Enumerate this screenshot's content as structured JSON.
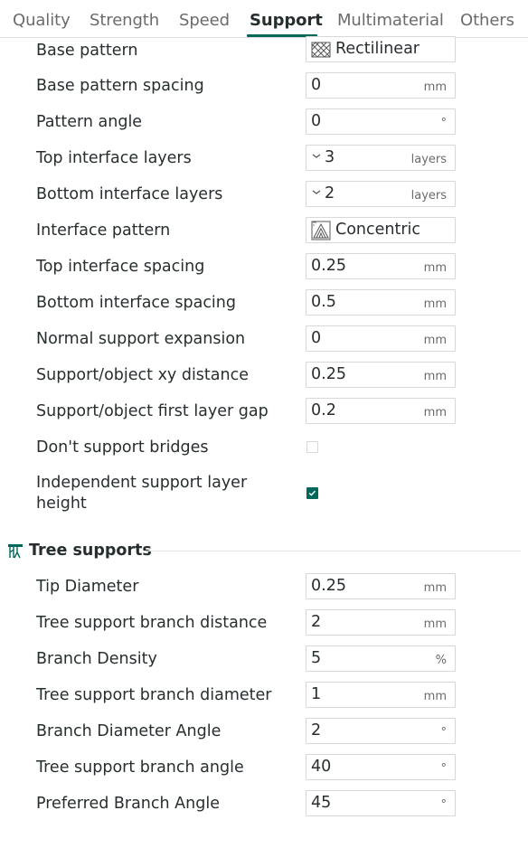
{
  "tabs": [
    {
      "label": "Quality"
    },
    {
      "label": "Strength"
    },
    {
      "label": "Speed"
    },
    {
      "label": "Support"
    },
    {
      "label": "Multimaterial"
    },
    {
      "label": "Others"
    }
  ],
  "active_tab": "Support",
  "accent_color": "#00675b",
  "settings": [
    {
      "label": "Base pattern",
      "value": "Rectilinear",
      "icon": "rectilinear-pattern-icon"
    },
    {
      "label": "Base pattern spacing",
      "value": "0",
      "unit": "mm"
    },
    {
      "label": "Pattern angle",
      "value": "0",
      "unit": "°"
    },
    {
      "label": "Top interface layers",
      "value": "3",
      "unit": "layers"
    },
    {
      "label": "Bottom interface layers",
      "value": "2",
      "unit": "layers"
    },
    {
      "label": "Interface pattern",
      "value": "Concentric",
      "icon": "concentric-pattern-icon"
    },
    {
      "label": "Top interface spacing",
      "value": "0.25",
      "unit": "mm"
    },
    {
      "label": "Bottom interface spacing",
      "value": "0.5",
      "unit": "mm"
    },
    {
      "label": "Normal support expansion",
      "value": "0",
      "unit": "mm"
    },
    {
      "label": "Support/object xy distance",
      "value": "0.25",
      "unit": "mm"
    },
    {
      "label": "Support/object first layer gap",
      "value": "0.2",
      "unit": "mm"
    },
    {
      "label": "Don't support bridges",
      "checked": false
    },
    {
      "label": "Independent support layer height",
      "checked": true
    }
  ],
  "tree_section": {
    "title": "Tree supports",
    "icon": "tree-support-icon",
    "settings": [
      {
        "label": "Tip Diameter",
        "value": "0.25",
        "unit": "mm"
      },
      {
        "label": "Tree support branch distance",
        "value": "2",
        "unit": "mm"
      },
      {
        "label": "Branch Density",
        "value": "5",
        "unit": "%"
      },
      {
        "label": "Tree support branch diameter",
        "value": "1",
        "unit": "mm"
      },
      {
        "label": "Branch Diameter Angle",
        "value": "2",
        "unit": "°"
      },
      {
        "label": "Tree support branch angle",
        "value": "40",
        "unit": "°"
      },
      {
        "label": "Preferred Branch Angle",
        "value": "45",
        "unit": "°"
      }
    ]
  }
}
